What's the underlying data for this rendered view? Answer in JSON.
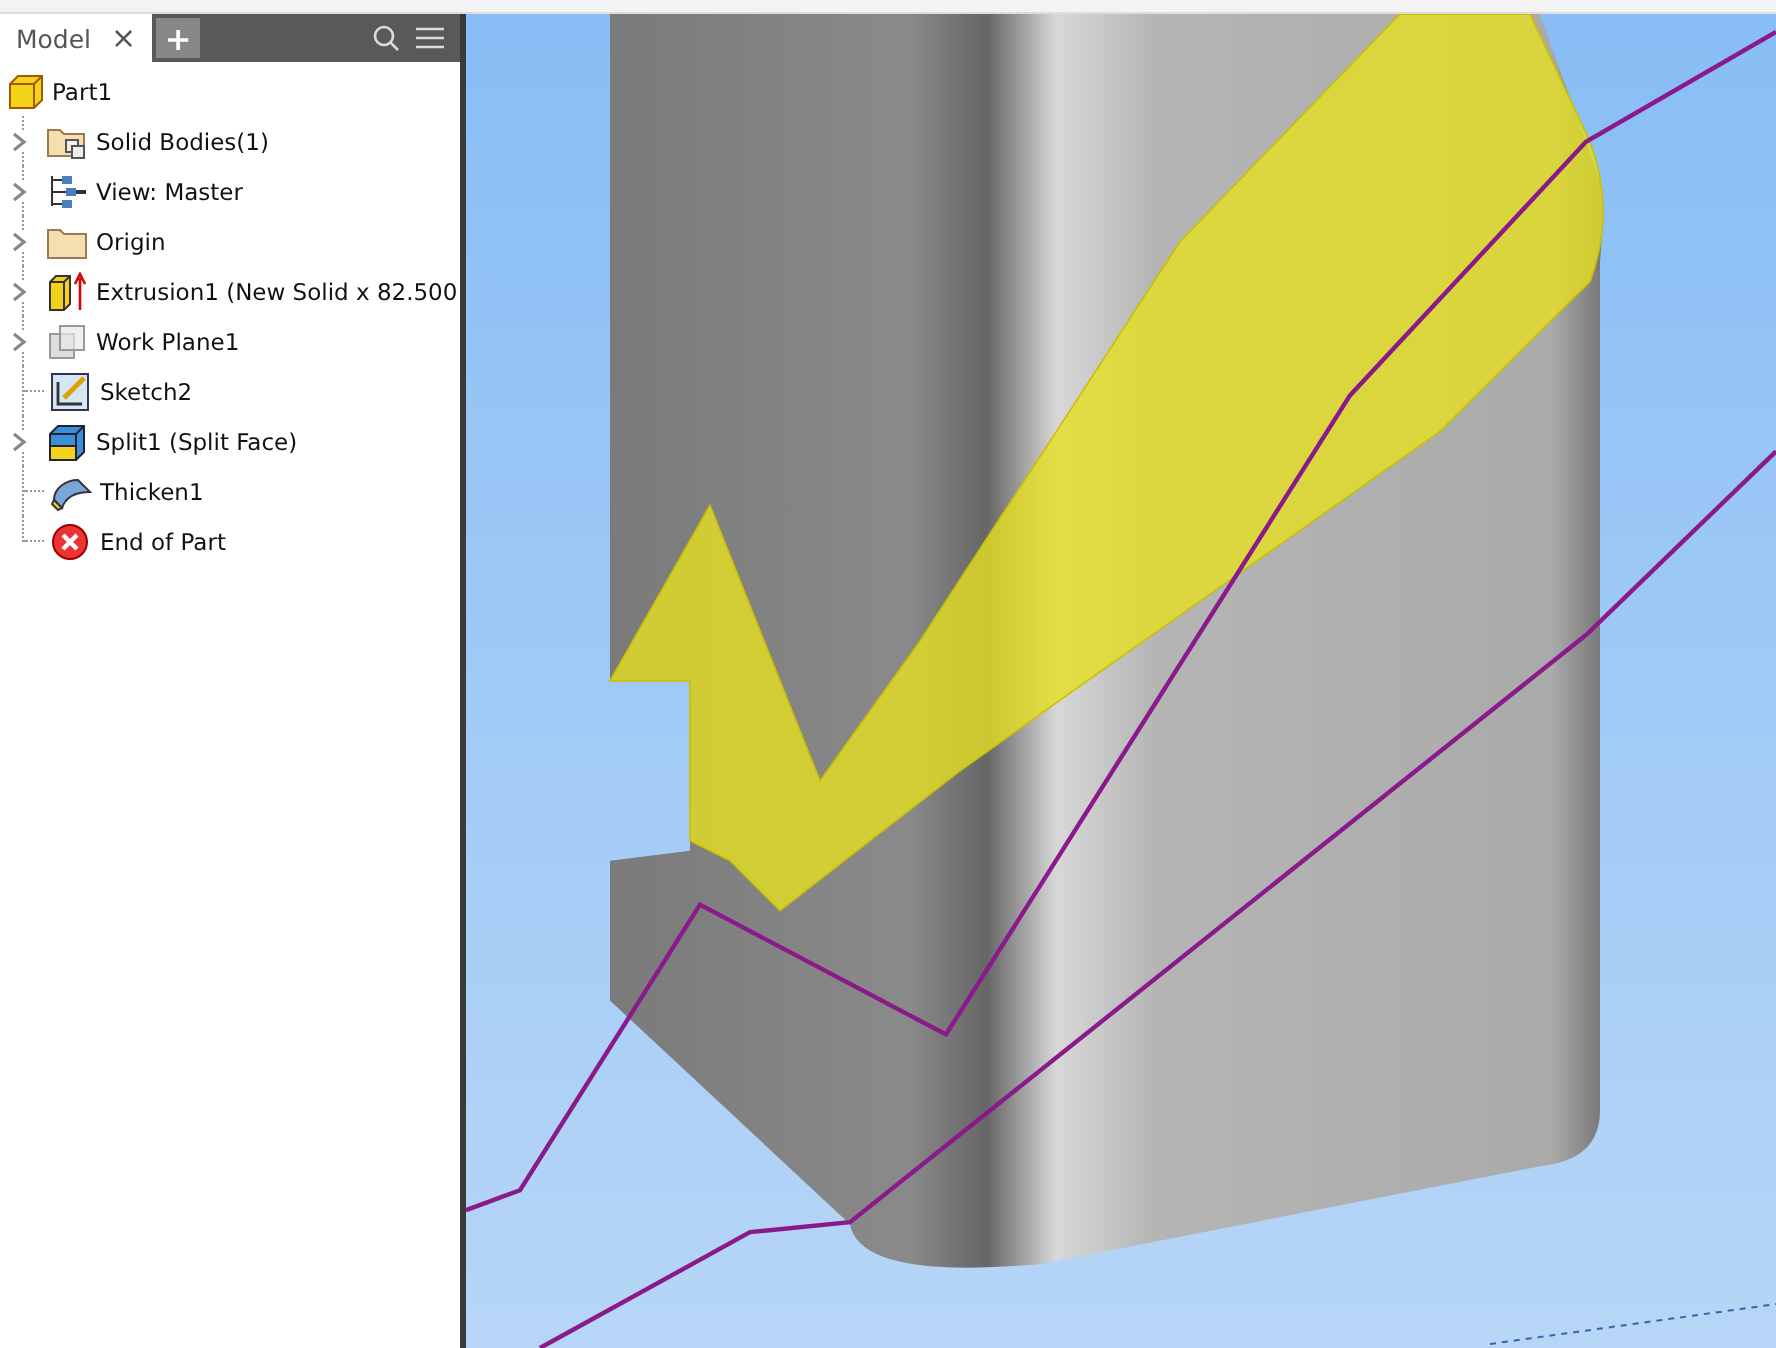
{
  "browser": {
    "tabs": [
      {
        "label": "Model",
        "selected": true,
        "close": "×"
      }
    ],
    "add_tab": "+",
    "tree": {
      "label": "Part1",
      "children": [
        {
          "label": "Solid Bodies(1)",
          "expandable": true
        },
        {
          "label": "View: Master",
          "expandable": true
        },
        {
          "label": "Origin",
          "expandable": true
        },
        {
          "label": "Extrusion1 (New Solid x 82.500",
          "expandable": true
        },
        {
          "label": "Work Plane1",
          "expandable": true
        },
        {
          "label": "Sketch2",
          "expandable": false
        },
        {
          "label": "Split1 (Split Face)",
          "expandable": true
        },
        {
          "label": "Thicken1",
          "expandable": false
        },
        {
          "label": "End of Part",
          "expandable": false
        }
      ]
    }
  }
}
